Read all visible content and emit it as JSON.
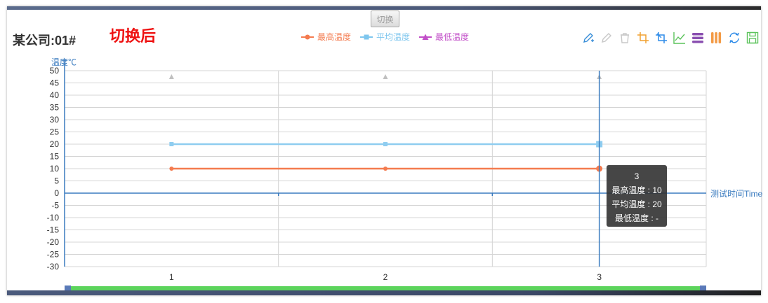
{
  "header": {
    "toggle_label": "切换",
    "company_title": "某公司:01#",
    "status_text": "切换后"
  },
  "legend": [
    {
      "name": "最高温度",
      "color": "#f47b4f",
      "marker": "circle"
    },
    {
      "name": "平均温度",
      "color": "#7ec6ee",
      "marker": "square"
    },
    {
      "name": "最低温度",
      "color": "#c24fc8",
      "marker": "triangle"
    }
  ],
  "toolbox": [
    {
      "icon": "draw-pen-icon",
      "color": "#3a8fd8"
    },
    {
      "icon": "eraser-pen-icon",
      "color": "#c8c8c8"
    },
    {
      "icon": "clear-trash-icon",
      "color": "#c8c8c8"
    },
    {
      "icon": "data-zoom-icon",
      "color": "#f0a030"
    },
    {
      "icon": "zoom-reset-icon",
      "color": "#2f8ce8"
    },
    {
      "icon": "line-chart-icon",
      "color": "#5bc35b"
    },
    {
      "icon": "stack-icon",
      "color": "#8a4fb0"
    },
    {
      "icon": "tiled-icon",
      "color": "#f39a45"
    },
    {
      "icon": "restore-icon",
      "color": "#2f8ce8"
    },
    {
      "icon": "save-image-icon",
      "color": "#5bc35b"
    }
  ],
  "chart_data": {
    "type": "line",
    "ylabel": "温度℃",
    "xlabel": "测试时间Time",
    "categories": [
      "1",
      "2",
      "3"
    ],
    "ylim": [
      -30,
      50
    ],
    "yticks": [
      -30,
      -25,
      -20,
      -15,
      -10,
      -5,
      0,
      5,
      10,
      15,
      20,
      25,
      30,
      35,
      40,
      45,
      50
    ],
    "grid": true,
    "series": [
      {
        "name": "最高温度",
        "values": [
          10,
          10,
          10
        ],
        "color": "#f47b4f",
        "marker": "circle"
      },
      {
        "name": "平均温度",
        "values": [
          20,
          20,
          20
        ],
        "color": "#8fcdf0",
        "marker": "square"
      },
      {
        "name": "最低温度",
        "values": [
          null,
          null,
          null
        ],
        "color": "#c0c0c0",
        "marker": "triangle"
      }
    ],
    "tooltip": {
      "title": "3",
      "lines": [
        "最高温度 : 10",
        "平均温度 : 20",
        "最低温度 : -"
      ]
    }
  }
}
